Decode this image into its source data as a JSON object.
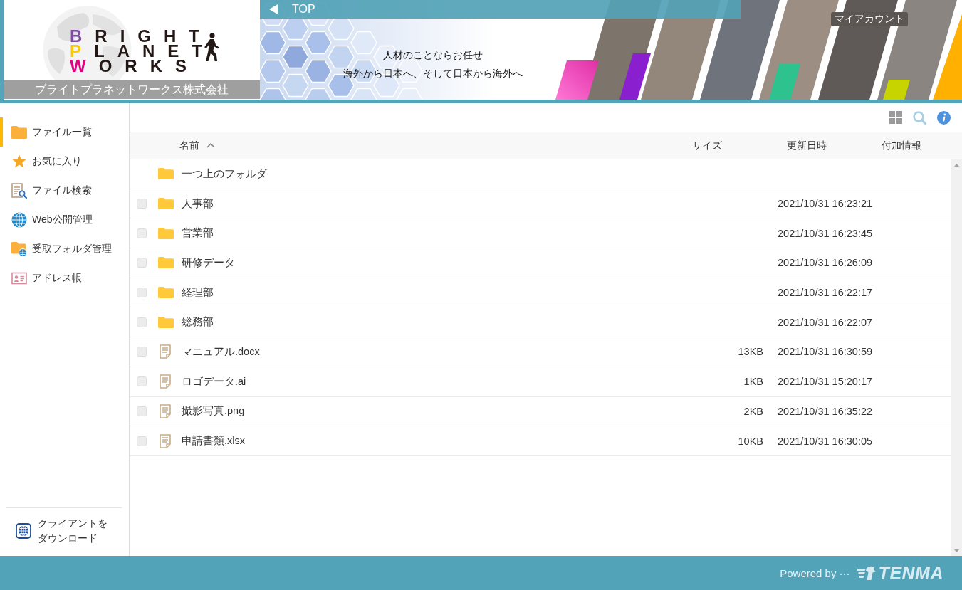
{
  "header": {
    "logo": {
      "lines": [
        {
          "initial": "B",
          "rest": "RIGHT",
          "color": "#7e4ea3"
        },
        {
          "initial": "P",
          "rest": "LANET",
          "color": "#f5c90e"
        },
        {
          "initial": "W",
          "rest": "ORKS",
          "color": "#e4007f"
        }
      ],
      "company": "ブライトプラネットワークス株式会社"
    },
    "banner": {
      "nav": {
        "label": "TOP"
      },
      "account_link": "マイアカウント",
      "tagline": [
        "人材のことならお任せ",
        "海外から日本へ、そして日本から海外へ"
      ]
    }
  },
  "sidebar": {
    "items": [
      {
        "kind": "files",
        "label": "ファイル一覧",
        "selected": true
      },
      {
        "kind": "favorites",
        "label": "お気に入り",
        "selected": false
      },
      {
        "kind": "search",
        "label": "ファイル検索",
        "selected": false
      },
      {
        "kind": "web",
        "label": "Web公開管理",
        "selected": false
      },
      {
        "kind": "inbox",
        "label": "受取フォルダ管理",
        "selected": false
      },
      {
        "kind": "addressbook",
        "label": "アドレス帳",
        "selected": false
      }
    ],
    "download": {
      "label": "クライアントをダウンロード"
    }
  },
  "table": {
    "columns": [
      {
        "label": "名前",
        "sorted": true
      },
      {
        "label": "サイズ",
        "sorted": false
      },
      {
        "label": "更新日時",
        "sorted": false
      },
      {
        "label": "付加情報",
        "sorted": false
      }
    ],
    "rows": [
      {
        "kind": "parent",
        "name": "一つ上のフォルダ"
      },
      {
        "kind": "folder",
        "name": "人事部",
        "modified": "2021/10/31 16:23:21",
        "checked": false
      },
      {
        "kind": "folder",
        "name": "営業部",
        "modified": "2021/10/31 16:23:45",
        "checked": false
      },
      {
        "kind": "folder",
        "name": "研修データ",
        "modified": "2021/10/31 16:26:09",
        "checked": false
      },
      {
        "kind": "folder",
        "name": "経理部",
        "modified": "2021/10/31 16:22:17",
        "checked": false
      },
      {
        "kind": "folder",
        "name": "総務部",
        "modified": "2021/10/31 16:22:07",
        "checked": false
      },
      {
        "kind": "file",
        "name": "マニュアル.docx",
        "size": "13KB",
        "modified": "2021/10/31 16:30:59",
        "checked": false
      },
      {
        "kind": "file",
        "name": "ロゴデータ.ai",
        "size": "1KB",
        "modified": "2021/10/31 15:20:17",
        "checked": false
      },
      {
        "kind": "file",
        "name": "撮影写真.png",
        "size": "2KB",
        "modified": "2021/10/31 16:35:22",
        "checked": false
      },
      {
        "kind": "file",
        "name": "申請書類.xlsx",
        "size": "10KB",
        "modified": "2021/10/31 16:30:05",
        "checked": false
      }
    ]
  },
  "footer": {
    "powered_by": "Powered by ···",
    "brand": "TENMA"
  }
}
